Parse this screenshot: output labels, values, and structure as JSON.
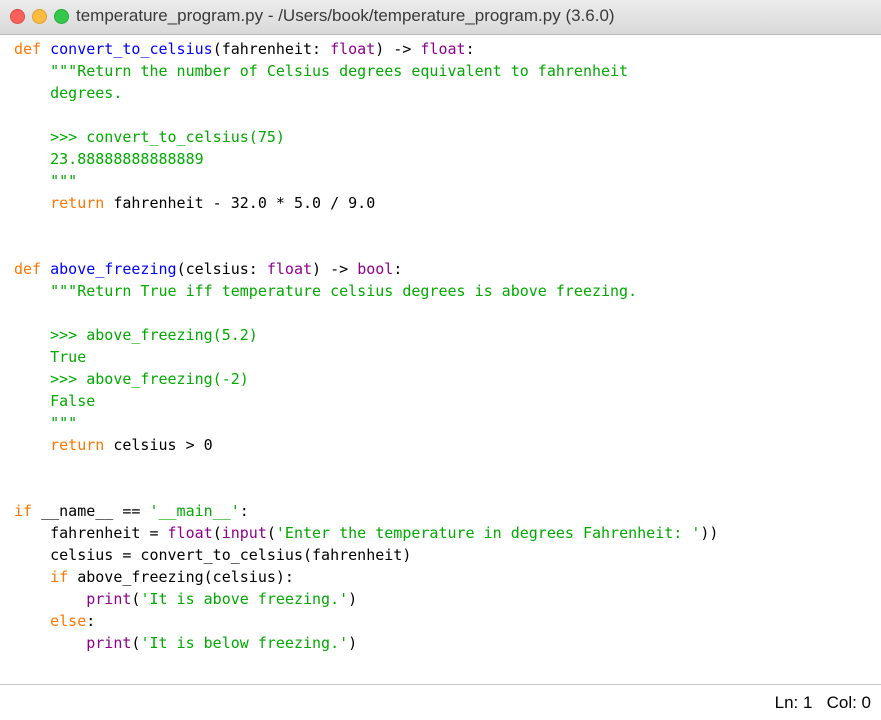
{
  "window": {
    "title": "temperature_program.py - /Users/book/temperature_program.py (3.6.0)"
  },
  "colors": {
    "keyword": "#ff7700",
    "builtin": "#900090",
    "definition": "#0000ff",
    "string": "#00aa00",
    "text": "#000000"
  },
  "code": {
    "lines": [
      [
        {
          "t": "def",
          "c": "kw"
        },
        {
          "t": " "
        },
        {
          "t": "convert_to_celsius",
          "c": "fn"
        },
        {
          "t": "(fahrenheit: "
        },
        {
          "t": "float",
          "c": "bi"
        },
        {
          "t": ") -> "
        },
        {
          "t": "float",
          "c": "bi"
        },
        {
          "t": ":"
        }
      ],
      [
        {
          "t": "    \"\"\"Return the number of Celsius degrees equivalent to fahrenheit",
          "c": "st"
        }
      ],
      [
        {
          "t": "    degrees.",
          "c": "st"
        }
      ],
      [],
      [
        {
          "t": "    >>> convert_to_celsius(75)",
          "c": "st"
        }
      ],
      [
        {
          "t": "    23.88888888888889",
          "c": "st"
        }
      ],
      [
        {
          "t": "    \"\"\"",
          "c": "st"
        }
      ],
      [
        {
          "t": "    "
        },
        {
          "t": "return",
          "c": "kw"
        },
        {
          "t": " fahrenheit - 32.0 * 5.0 / 9.0"
        }
      ],
      [],
      [],
      [
        {
          "t": "def",
          "c": "kw"
        },
        {
          "t": " "
        },
        {
          "t": "above_freezing",
          "c": "fn"
        },
        {
          "t": "(celsius: "
        },
        {
          "t": "float",
          "c": "bi"
        },
        {
          "t": ") -> "
        },
        {
          "t": "bool",
          "c": "bi"
        },
        {
          "t": ":"
        }
      ],
      [
        {
          "t": "    \"\"\"Return True iff temperature celsius degrees is above freezing.",
          "c": "st"
        }
      ],
      [],
      [
        {
          "t": "    >>> above_freezing(5.2)",
          "c": "st"
        }
      ],
      [
        {
          "t": "    True",
          "c": "st"
        }
      ],
      [
        {
          "t": "    >>> above_freezing(-2)",
          "c": "st"
        }
      ],
      [
        {
          "t": "    False",
          "c": "st"
        }
      ],
      [
        {
          "t": "    \"\"\"",
          "c": "st"
        }
      ],
      [
        {
          "t": "    "
        },
        {
          "t": "return",
          "c": "kw"
        },
        {
          "t": " celsius > 0"
        }
      ],
      [],
      [],
      [
        {
          "t": "if",
          "c": "kw"
        },
        {
          "t": " __name__ == "
        },
        {
          "t": "'__main__'",
          "c": "st"
        },
        {
          "t": ":"
        }
      ],
      [
        {
          "t": "    fahrenheit = "
        },
        {
          "t": "float",
          "c": "bi"
        },
        {
          "t": "("
        },
        {
          "t": "input",
          "c": "bi"
        },
        {
          "t": "("
        },
        {
          "t": "'Enter the temperature in degrees Fahrenheit: '",
          "c": "st"
        },
        {
          "t": "))"
        }
      ],
      [
        {
          "t": "    celsius = convert_to_celsius(fahrenheit)"
        }
      ],
      [
        {
          "t": "    "
        },
        {
          "t": "if",
          "c": "kw"
        },
        {
          "t": " above_freezing(celsius):"
        }
      ],
      [
        {
          "t": "        "
        },
        {
          "t": "print",
          "c": "bi"
        },
        {
          "t": "("
        },
        {
          "t": "'It is above freezing.'",
          "c": "st"
        },
        {
          "t": ")"
        }
      ],
      [
        {
          "t": "    "
        },
        {
          "t": "else",
          "c": "kw"
        },
        {
          "t": ":"
        }
      ],
      [
        {
          "t": "        "
        },
        {
          "t": "print",
          "c": "bi"
        },
        {
          "t": "("
        },
        {
          "t": "'It is below freezing.'",
          "c": "st"
        },
        {
          "t": ")"
        }
      ]
    ]
  },
  "status_bar": {
    "cursor_position": "Ln: 1   Col: 0"
  }
}
